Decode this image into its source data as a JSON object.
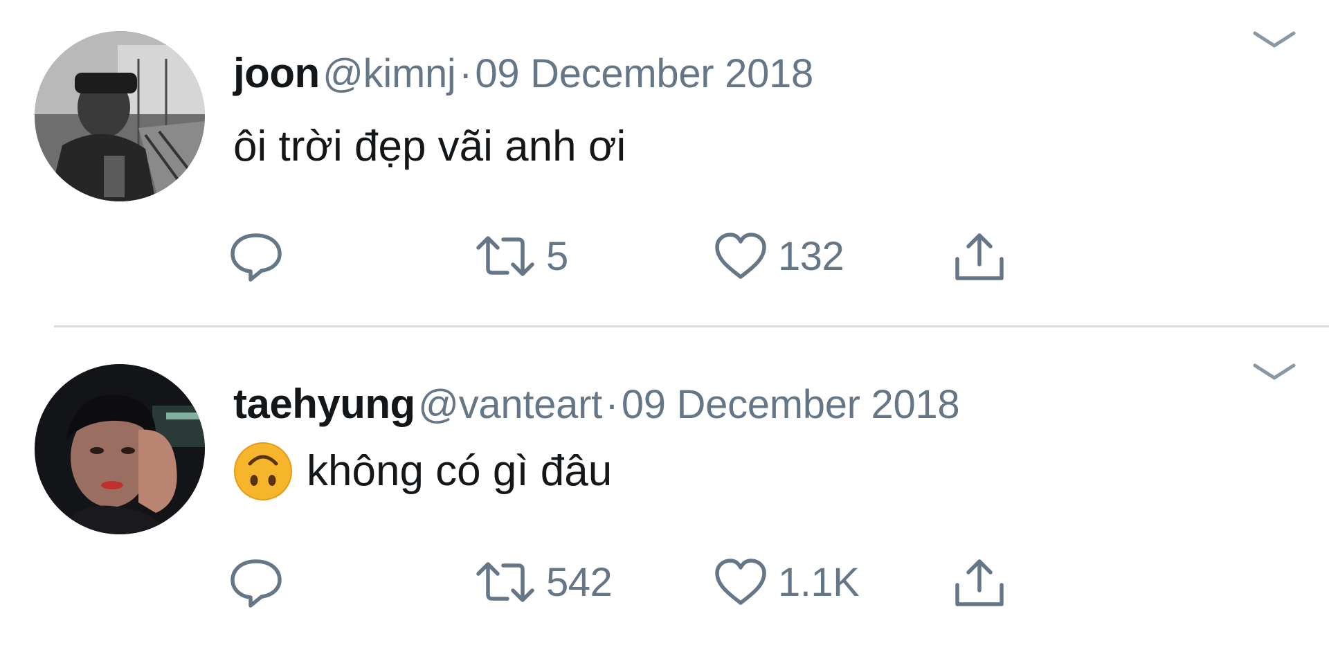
{
  "tweets": [
    {
      "display_name": "joon",
      "handle": "@kimnj",
      "separator": "·",
      "date": "09 December 2018",
      "text": "ôi trời đẹp vãi anh ơi",
      "emoji": null,
      "retweets": "5",
      "likes": "132"
    },
    {
      "display_name": "taehyung",
      "handle": "@vanteart",
      "separator": "·",
      "date": "09 December 2018",
      "text": "không có gì đâu",
      "emoji": "upside-down-face",
      "retweets": "542",
      "likes": "1.1K"
    }
  ],
  "colors": {
    "text_primary": "#14171a",
    "text_secondary": "#657786",
    "divider": "#d8dde2",
    "emoji_yellow": "#f7b52c"
  },
  "icons": {
    "reply": "speech-bubble-icon",
    "retweet": "retweet-arrows-icon",
    "like": "heart-outline-icon",
    "share": "share-upload-icon",
    "more": "chevron-down-icon"
  }
}
